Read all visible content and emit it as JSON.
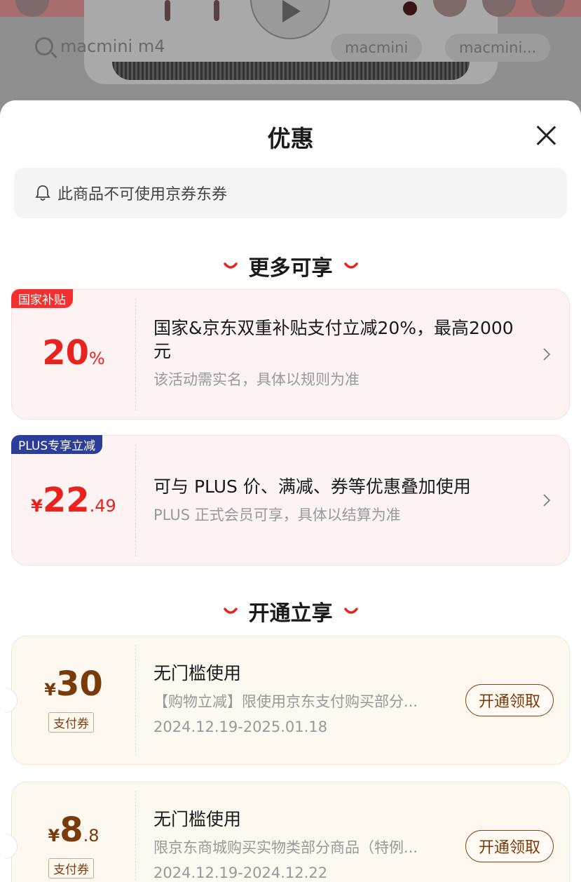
{
  "background": {
    "search_query": "macmini m4",
    "chips": [
      "macmini",
      "macmini..."
    ]
  },
  "sheet": {
    "title": "优惠",
    "notice": "此商品不可使用京券东券"
  },
  "sections": {
    "more": "更多可享",
    "open": "开通立享"
  },
  "promos": [
    {
      "tag": "国家补贴",
      "amount": "20",
      "amount_suffix": "%",
      "title": "国家&京东双重补贴支付立减20%，最高2000元",
      "sub": "该活动需实名，具体以规则为准"
    },
    {
      "tag": "PLUS专享立减",
      "currency": "¥",
      "amount": "22",
      "amount_suffix": ".49",
      "title": "可与 PLUS 价、满减、券等优惠叠加使用",
      "sub": "PLUS 正式会员可享，具体以结算为准"
    }
  ],
  "coupons": [
    {
      "currency": "¥",
      "amount": "30",
      "amount_suffix": "",
      "badge": "支付券",
      "title": "无门槛使用",
      "sub": "【购物立减】限使用京东支付购买部分...",
      "date": "2024.12.19-2025.01.18",
      "button": "开通领取"
    },
    {
      "currency": "¥",
      "amount": "8",
      "amount_suffix": ".8",
      "badge": "支付券",
      "title": "无门槛使用",
      "sub": "限京东商城购买实物类部分商品（特例...",
      "date": "2024.12.19-2024.12.22",
      "button": "开通领取"
    }
  ],
  "colors": {
    "accent_red": "#e8231f",
    "gold_text": "#7a3b0b",
    "plus_blue": "#2d3e9a"
  },
  "icons": [
    "bell-icon",
    "close-icon",
    "chevron-right-icon",
    "smile-icon",
    "search-icon",
    "play-icon"
  ]
}
